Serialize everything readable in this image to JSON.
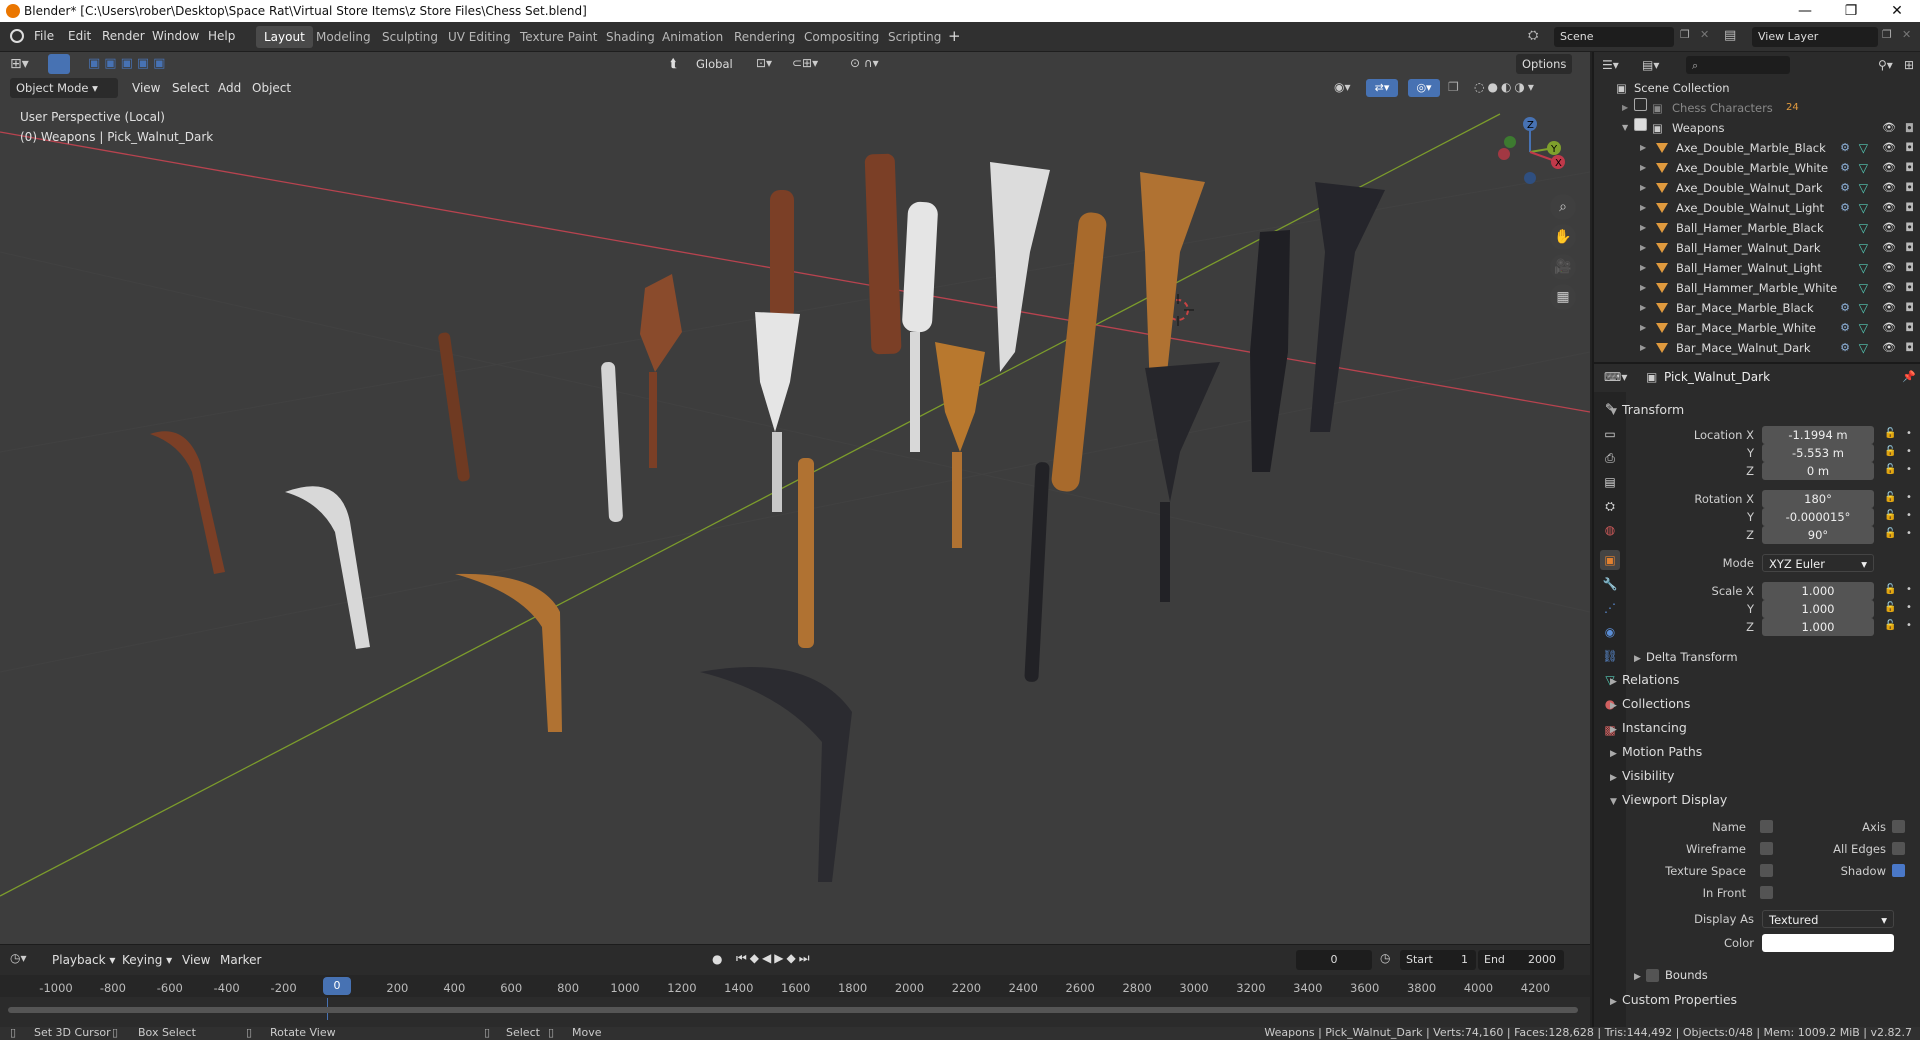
{
  "titlebar": {
    "title": "Blender* [C:\\Users\\rober\\Desktop\\Space Rat\\Virtual Store Items\\z Store Files\\Chess Set.blend]",
    "minimize": "—",
    "maximize": "❐",
    "close": "✕"
  },
  "menu": [
    "File",
    "Edit",
    "Render",
    "Window",
    "Help"
  ],
  "workspaces": [
    "Layout",
    "Modeling",
    "Sculpting",
    "UV Editing",
    "Texture Paint",
    "Shading",
    "Animation",
    "Rendering",
    "Compositing",
    "Scripting"
  ],
  "workspace_add": "+",
  "scene": {
    "label": "Scene",
    "view_layer": "View Layer"
  },
  "header": {
    "transform_orientation": "Global",
    "options": "Options"
  },
  "viewport": {
    "mode": "Object Mode",
    "menus": [
      "View",
      "Select",
      "Add",
      "Object"
    ],
    "perspective": "User Perspective (Local)",
    "context": "(0) Weapons | Pick_Walnut_Dark",
    "gizmo": {
      "x": "X",
      "y": "Y",
      "z": "Z"
    }
  },
  "outliner": {
    "root": "Scene Collection",
    "collections": [
      {
        "name": "Chess Characters",
        "count": "24"
      },
      {
        "name": "Weapons"
      }
    ],
    "items": [
      "Axe_Double_Marble_Black",
      "Axe_Double_Marble_White",
      "Axe_Double_Walnut_Dark",
      "Axe_Double_Walnut_Light",
      "Ball_Hamer_Marble_Black",
      "Ball_Hamer_Walnut_Dark",
      "Ball_Hamer_Walnut_Light",
      "Ball_Hammer_Marble_White",
      "Bar_Mace_Marble_Black",
      "Bar_Mace_Marble_White",
      "Bar_Mace_Walnut_Dark"
    ]
  },
  "properties": {
    "object_name": "Pick_Walnut_Dark",
    "transform_title": "Transform",
    "location": {
      "label_x": "Location X",
      "x": "-1.1994 m",
      "y": "-5.553 m",
      "z": "0 m"
    },
    "rotation": {
      "label_x": "Rotation X",
      "x": "180°",
      "y": "-0.000015°",
      "z": "90°"
    },
    "mode_label": "Mode",
    "mode_value": "XYZ Euler",
    "scale": {
      "label_x": "Scale X",
      "x": "1.000",
      "y": "1.000",
      "z": "1.000"
    },
    "axis_y": "Y",
    "axis_z": "Z",
    "sections": [
      "Delta Transform",
      "Relations",
      "Collections",
      "Instancing",
      "Motion Paths",
      "Visibility",
      "Viewport Display"
    ],
    "viewport_display": {
      "name": "Name",
      "axis": "Axis",
      "wireframe": "Wireframe",
      "all_edges": "All Edges",
      "texture_space": "Texture Space",
      "shadow": "Shadow",
      "in_front": "In Front",
      "display_as_label": "Display As",
      "display_as": "Textured",
      "color_label": "Color",
      "bounds": "Bounds",
      "custom_properties": "Custom Properties"
    },
    "color_value": "#ffffff"
  },
  "timeline": {
    "menus": [
      "Playback",
      "Keying",
      "View",
      "Marker"
    ],
    "current_frame": "0",
    "start_label": "Start",
    "start": "1",
    "end_label": "End",
    "end": "2000",
    "ticks": [
      "-1000",
      "-800",
      "-600",
      "-400",
      "-200",
      "0",
      "200",
      "400",
      "600",
      "800",
      "1000",
      "1200",
      "1400",
      "1600",
      "1800",
      "2000",
      "2200",
      "2400",
      "2600",
      "2800",
      "3000",
      "3200",
      "3400",
      "3600",
      "3800",
      "4000",
      "4200"
    ],
    "playhead": "0"
  },
  "statusbar": {
    "set_cursor": "Set 3D Cursor",
    "box_select": "Box Select",
    "rotate_view": "Rotate View",
    "select": "Select",
    "move": "Move",
    "stats": "Weapons | Pick_Walnut_Dark | Verts:74,160 | Faces:128,628 | Tris:144,492 | Objects:0/48 | Mem: 1009.2 MiB | v2.82.7"
  },
  "colors": {
    "accent": "#4772b3",
    "x_axis": "#c0394a",
    "y_axis": "#7fa02c",
    "selection": "#ea7600"
  }
}
